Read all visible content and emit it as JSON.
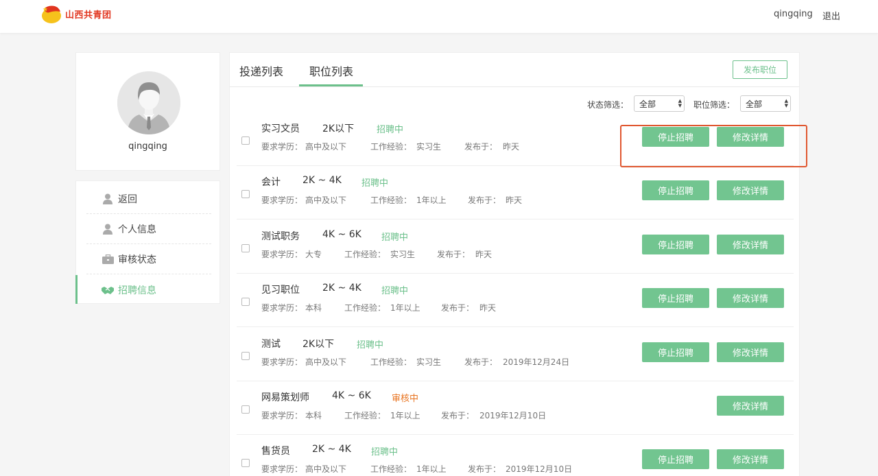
{
  "header": {
    "logo_text": "山西共青团",
    "username": "qingqing",
    "logout_label": "退出"
  },
  "profile": {
    "name": "qingqing"
  },
  "sidebar": {
    "items": [
      {
        "label": "返回",
        "icon": "user-icon"
      },
      {
        "label": "个人信息",
        "icon": "user-icon"
      },
      {
        "label": "审核状态",
        "icon": "briefcase-icon"
      },
      {
        "label": "招聘信息",
        "icon": "handshake-icon",
        "active": true
      }
    ]
  },
  "main": {
    "tabs": [
      {
        "label": "投递列表"
      },
      {
        "label": "职位列表",
        "active": true
      }
    ],
    "publish_label": "发布职位",
    "filters": {
      "status_label": "状态筛选：",
      "status_value": "全部",
      "position_label": "职位筛选：",
      "position_value": "全部"
    },
    "labels": {
      "education": "要求学历：",
      "experience": "工作经验：",
      "published": "发布于：",
      "stop_button": "停止招聘",
      "edit_button": "修改详情"
    },
    "jobs": [
      {
        "title": "实习文员",
        "salary": "2K以下",
        "status": "招聘中",
        "education": "高中及以下",
        "experience": "实习生",
        "published": "昨天"
      },
      {
        "title": "会计",
        "salary": "2K ~ 4K",
        "status": "招聘中",
        "education": "高中及以下",
        "experience": "1年以上",
        "published": "昨天"
      },
      {
        "title": "测试职务",
        "salary": "4K ~ 6K",
        "status": "招聘中",
        "education": "大专",
        "experience": "实习生",
        "published": "昨天"
      },
      {
        "title": "见习职位",
        "salary": "2K ~ 4K",
        "status": "招聘中",
        "education": "本科",
        "experience": "1年以上",
        "published": "昨天"
      },
      {
        "title": "测试",
        "salary": "2K以下",
        "status": "招聘中",
        "education": "高中及以下",
        "experience": "实习生",
        "published": "2019年12月24日"
      },
      {
        "title": "网易策划师",
        "salary": "4K ~ 6K",
        "status": "审核中",
        "education": "本科",
        "experience": "1年以上",
        "published": "2019年12月10日"
      },
      {
        "title": "售货员",
        "salary": "2K ~ 4K",
        "status": "招聘中",
        "education": "高中及以下",
        "experience": "1年以上",
        "published": "2019年12月10日"
      }
    ]
  },
  "colors": {
    "accent": "#6cc08b",
    "button": "#72c590",
    "reviewing": "#e8731f",
    "highlight": "#e0562f",
    "logo_red": "#e1351f"
  }
}
